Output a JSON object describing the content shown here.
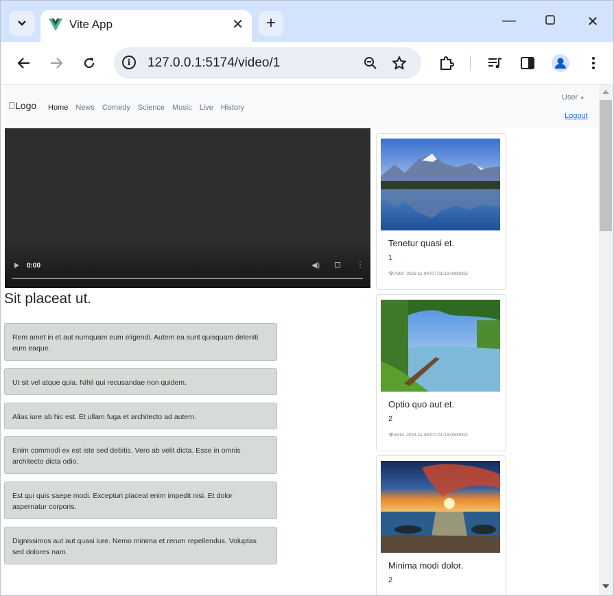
{
  "browser": {
    "tab_title": "Vite App",
    "url": "127.0.0.1:5174/video/1",
    "accent": "#d3e3fd"
  },
  "navbar": {
    "logo_alt": "Logo",
    "links": [
      "Home",
      "News",
      "Comedy",
      "Science",
      "Music",
      "Live",
      "History"
    ],
    "active_link": "Home",
    "user_label": "User",
    "logout_label": "Logout"
  },
  "video": {
    "time": "0:00",
    "progress": 0
  },
  "video_title": "Sit placeat ut.",
  "comments": [
    "Rem amet in et aut numquam eum eligendi. Autem ea sunt quisquam deleniti eum eaque.",
    "Ut sit vel atque quia. Nihil qui recusandae non quidem.",
    "Alias iure ab hic est. Et ullam fuga et architecto ad autem.",
    "Enim commodi ex est iste sed debitis. Vero ab velit dicta. Esse in omnis architecto dicta odio.",
    "Est qui quis saepe modi. Excepturi placeat enim impedit nisi. Et dolor aspernatur corporis.",
    "Dignissimos aut aut quasi iure. Nemo minima et rerum repellendus. Voluptas sed dolores nam."
  ],
  "recommended": [
    {
      "title": "Tenetur quasi et.",
      "id": "1",
      "views": "7900",
      "date": "2023-11-04T07:01:23.000000Z",
      "image": "mountain-lake"
    },
    {
      "title": "Optio quo aut et.",
      "id": "2",
      "views": "1513",
      "date": "2023-11-04T07:01:23.000000Z",
      "image": "river-boat"
    },
    {
      "title": "Minima modi dolor.",
      "id": "2",
      "views": "",
      "date": "",
      "image": "sunset-beach"
    }
  ]
}
